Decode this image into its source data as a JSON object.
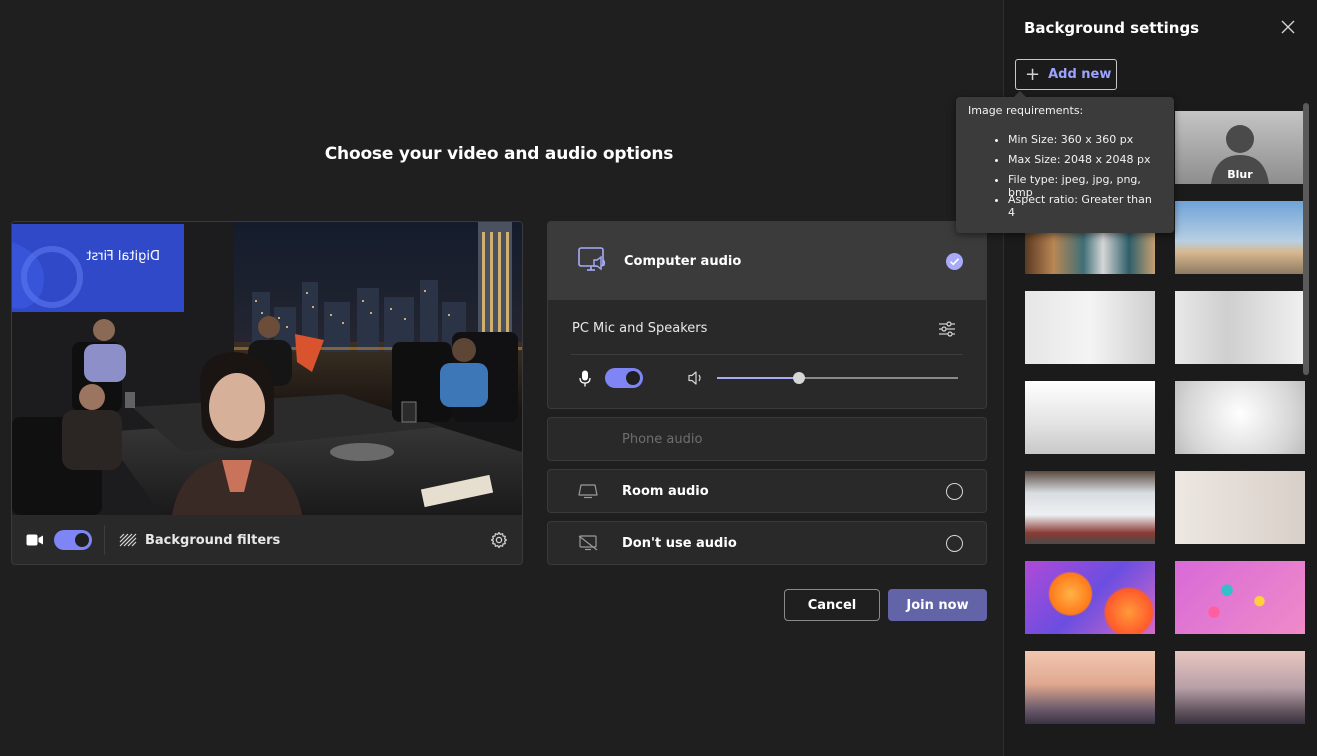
{
  "page": {
    "heading": "Choose your video and audio options"
  },
  "video": {
    "camera_toggle_on": true,
    "background_filters_label": "Background filters",
    "screen_text": "Digital First"
  },
  "audio": {
    "options": [
      {
        "label": "Computer audio",
        "selected": true
      },
      {
        "label": "Phone audio",
        "disabled": true
      },
      {
        "label": "Room audio",
        "selected": false
      },
      {
        "label": "Don't use audio",
        "selected": false
      }
    ],
    "device_label": "PC Mic and Speakers",
    "mic_toggle_on": true,
    "speaker_volume": 0.34
  },
  "actions": {
    "cancel_label": "Cancel",
    "join_label": "Join now"
  },
  "background_settings": {
    "title": "Background settings",
    "add_new_label": "Add new",
    "blur_label": "Blur",
    "tooltip": {
      "title": "Image requirements:",
      "items": [
        "Min Size: 360 x 360 px",
        "Max Size: 2048 x 2048 px",
        "File type: jpeg, jpg, png, bmp",
        "Aspect ratio: Greater than 4"
      ]
    }
  },
  "colors": {
    "accent": "#7f85f5",
    "join_button": "#6264a7",
    "add_new_text": "#9ea2ff",
    "background": "#1f1f1f",
    "card": "#292929",
    "selected_card": "#3b3b3b"
  }
}
